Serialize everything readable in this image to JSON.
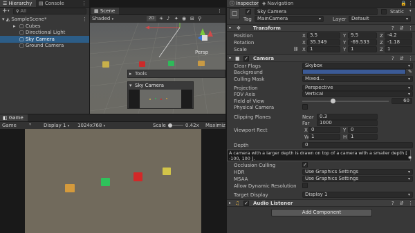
{
  "tabs": {
    "hierarchy": "Hierarchy",
    "console": "Console",
    "scene": "Scene",
    "game": "Game",
    "inspector": "Inspector",
    "navigation": "Navigation"
  },
  "hierarchy": {
    "search_placeholder": "All",
    "root": "SampleScene*",
    "items": [
      "Cubes",
      "Directional Light",
      "Sky Camera",
      "Ground Camera"
    ]
  },
  "scene_toolbar": {
    "shading": "Shaded",
    "mode_2d": "2D",
    "persp": "Persp",
    "tools": "Tools",
    "overlay_title": "Sky Camera"
  },
  "game_toolbar": {
    "display_type": "Game",
    "display": "Display 1",
    "resolution": "1024x768",
    "scale_label": "Scale",
    "scale_value": "0.42x",
    "maximize": "Maximiz"
  },
  "inspector": {
    "object_name": "Sky Camera",
    "static_label": "Static",
    "tag_label": "Tag",
    "tag_value": "MainCamera",
    "layer_label": "Layer",
    "layer_value": "Default",
    "transform": {
      "title": "Transform",
      "position_label": "Position",
      "rotation_label": "Rotation",
      "scale_label": "Scale",
      "position": {
        "x": "3.5",
        "y": "9.5",
        "z": "-4.2"
      },
      "rotation": {
        "x": "35.349",
        "y": "-69.533",
        "z": "-1.18"
      },
      "scale": {
        "x": "1",
        "y": "1",
        "z": "1"
      }
    },
    "camera": {
      "title": "Camera",
      "clear_flags_label": "Clear Flags",
      "clear_flags": "Skybox",
      "background_label": "Background",
      "background_color": "#3b5a96",
      "culling_mask_label": "Culling Mask",
      "culling_mask": "Mixed...",
      "projection_label": "Projection",
      "projection": "Perspective",
      "fov_axis_label": "FOV Axis",
      "fov_axis": "Vertical",
      "fov_label": "Field of View",
      "fov": "60",
      "fov_fraction": 0.33,
      "physical_label": "Physical Camera",
      "clipping_label": "Clipping Planes",
      "near_label": "Near",
      "near": "0.3",
      "far_label": "Far",
      "far": "1000",
      "viewport_label": "Viewport Rect",
      "vx_label": "X",
      "vx": "0",
      "vy_label": "Y",
      "vy": "0",
      "vw_label": "W",
      "vw": "1",
      "vh_label": "H",
      "vh": "1",
      "depth_label": "Depth",
      "depth": "0",
      "tooltip": "A camera with a larger depth is drawn on top of a camera with a smaller depth [ -100, 100 ].",
      "occlusion_label": "Occlusion Culling",
      "hdr_label": "HDR",
      "hdr": "Use Graphics Settings",
      "msaa_label": "MSAA",
      "msaa": "Use Graphics Settings",
      "dynres_label": "Allow Dynamic Resolution",
      "target_display_label": "Target Display",
      "target_display": "Display 1"
    },
    "audio_listener": {
      "title": "Audio Listener"
    },
    "add_component": "Add Component"
  }
}
